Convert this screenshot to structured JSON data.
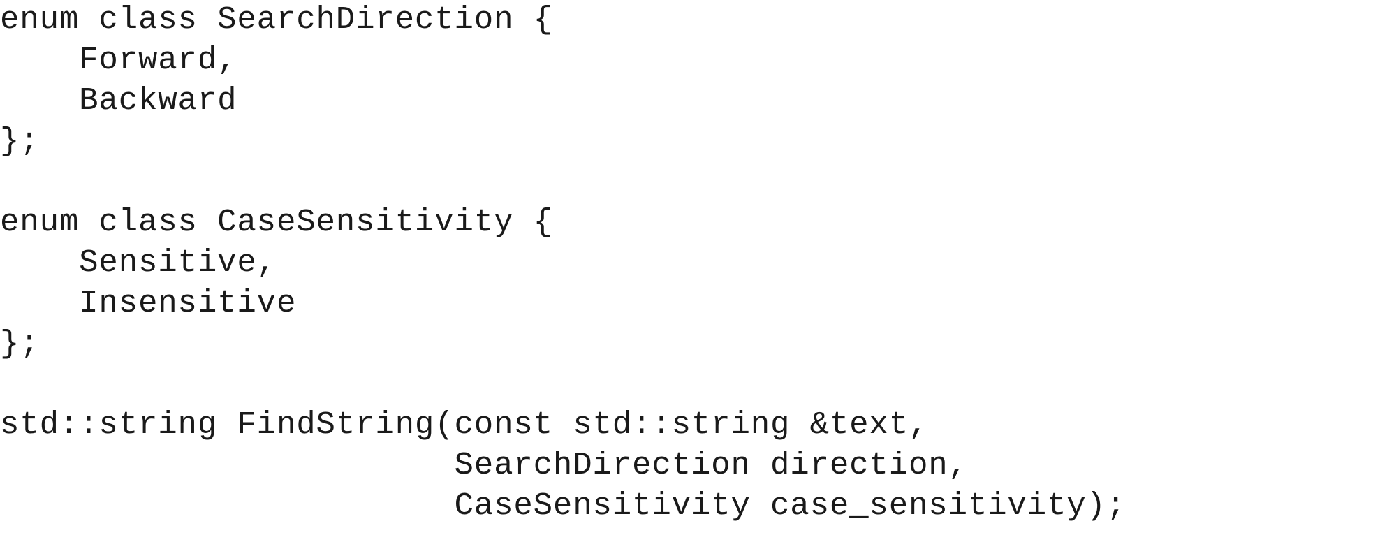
{
  "code": {
    "lines": [
      "enum class SearchDirection {",
      "    Forward,",
      "    Backward",
      "};",
      "",
      "enum class CaseSensitivity {",
      "    Sensitive,",
      "    Insensitive",
      "};",
      "",
      "std::string FindString(const std::string &text,",
      "                       SearchDirection direction,",
      "                       CaseSensitivity case_sensitivity);"
    ]
  }
}
